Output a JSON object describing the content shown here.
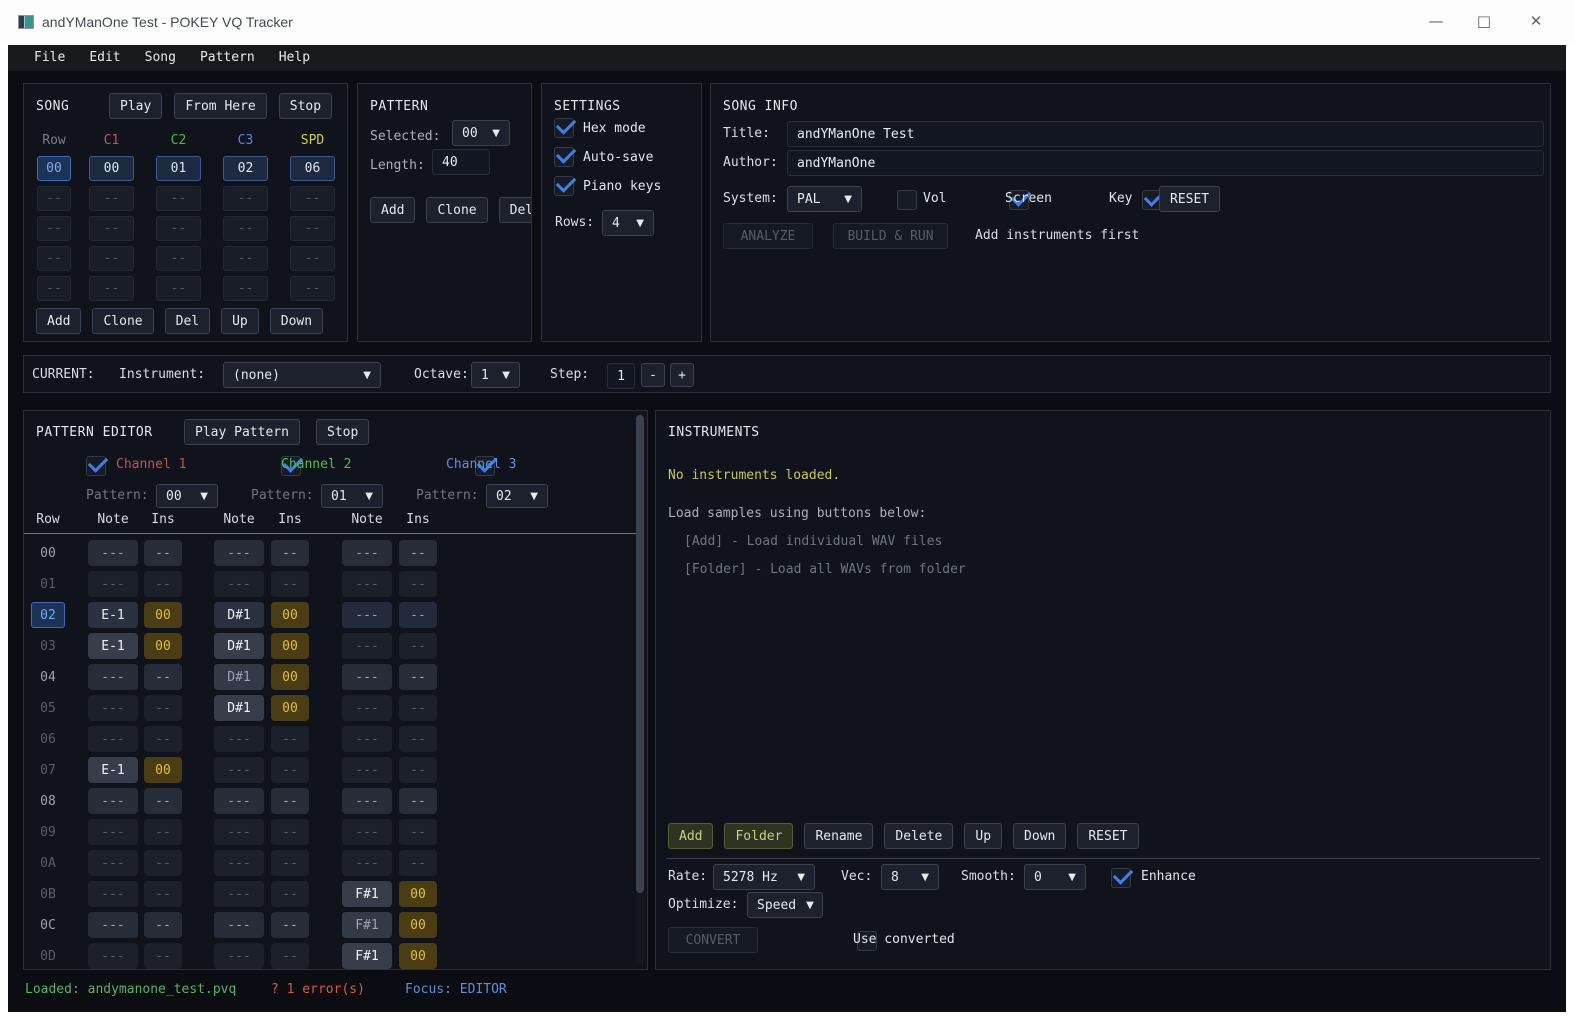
{
  "window": {
    "title": "andYManOne Test - POKEY VQ Tracker",
    "minimize": "—",
    "maximize": "□",
    "close": "✕"
  },
  "menu": [
    "File",
    "Edit",
    "Song",
    "Pattern",
    "Help"
  ],
  "song_panel": {
    "title": "SONG",
    "buttons": [
      "Play",
      "From Here",
      "Stop"
    ],
    "columns": [
      "Row",
      "C1",
      "C2",
      "C3",
      "SPD"
    ],
    "rows": [
      {
        "row": "00",
        "cells": [
          "00",
          "01",
          "02",
          "06"
        ],
        "selected": true
      },
      {
        "row": "--",
        "cells": [
          "--",
          "--",
          "--",
          "--"
        ],
        "selected": false
      },
      {
        "row": "--",
        "cells": [
          "--",
          "--",
          "--",
          "--"
        ],
        "selected": false
      },
      {
        "row": "--",
        "cells": [
          "--",
          "--",
          "--",
          "--"
        ],
        "selected": false
      },
      {
        "row": "--",
        "cells": [
          "--",
          "--",
          "--",
          "--"
        ],
        "selected": false
      }
    ],
    "footer_buttons": [
      "Add",
      "Clone",
      "Del",
      "Up",
      "Down"
    ]
  },
  "pattern_panel": {
    "title": "PATTERN",
    "selected_label": "Selected:",
    "selected_value": "00",
    "length_label": "Length:",
    "length_value": "40",
    "buttons": [
      "Add",
      "Clone",
      "Del"
    ]
  },
  "settings_panel": {
    "title": "SETTINGS",
    "checkboxes": [
      {
        "label": "Hex mode",
        "checked": true
      },
      {
        "label": "Auto-save",
        "checked": true
      },
      {
        "label": "Piano keys",
        "checked": true
      }
    ],
    "rows_label": "Rows:",
    "rows_value": "4"
  },
  "song_info": {
    "title": "SONG INFO",
    "title_label": "Title:",
    "title_value": "andYManOne Test",
    "author_label": "Author:",
    "author_value": "andYManOne",
    "system_label": "System:",
    "system_value": "PAL",
    "vol_label": "Vol",
    "vol_checked": false,
    "screen_label": "Screen",
    "screen_checked": true,
    "key_label": "Key",
    "key_checked": true,
    "reset_label": "RESET",
    "analyze_label": "ANALYZE",
    "build_label": "BUILD & RUN",
    "hint": "Add instruments first"
  },
  "current_bar": {
    "label": "CURRENT:",
    "instrument_label": "Instrument:",
    "instrument_value": "(none)",
    "octave_label": "Octave:",
    "octave_value": "1",
    "step_label": "Step:",
    "step_value": "1",
    "minus_label": "-",
    "plus_label": "+"
  },
  "pattern_editor": {
    "title": "PATTERN EDITOR",
    "play_label": "Play Pattern",
    "stop_label": "Stop",
    "pattern_label": "Pattern:",
    "channels": [
      {
        "label": "Channel 1",
        "checked": true,
        "color": "#c75050",
        "pattern_value": "00"
      },
      {
        "label": "Channel 2",
        "checked": true,
        "color": "#4fbf4f",
        "pattern_value": "01"
      },
      {
        "label": "Channel 3",
        "checked": true,
        "color": "#5d8fdd",
        "pattern_value": "02"
      }
    ],
    "columns": [
      "Row",
      "Note",
      "Ins",
      "Note",
      "Ins",
      "Note",
      "Ins"
    ],
    "rows": [
      {
        "row": "00",
        "beat": true,
        "selected": false,
        "cells": [
          {
            "note": "---",
            "ins": "--"
          },
          {
            "note": "---",
            "ins": "--"
          },
          {
            "note": "---",
            "ins": "--"
          }
        ]
      },
      {
        "row": "01",
        "beat": false,
        "selected": false,
        "cells": [
          {
            "note": "---",
            "ins": "--"
          },
          {
            "note": "---",
            "ins": "--"
          },
          {
            "note": "---",
            "ins": "--"
          }
        ]
      },
      {
        "row": "02",
        "beat": false,
        "selected": true,
        "cells": [
          {
            "note": "E-1",
            "ins": "00"
          },
          {
            "note": "D#1",
            "ins": "00"
          },
          {
            "note": "---",
            "ins": "--",
            "cursor": true
          }
        ]
      },
      {
        "row": "03",
        "beat": false,
        "selected": false,
        "cells": [
          {
            "note": "E-1",
            "ins": "00"
          },
          {
            "note": "D#1",
            "ins": "00"
          },
          {
            "note": "---",
            "ins": "--"
          }
        ]
      },
      {
        "row": "04",
        "beat": true,
        "selected": false,
        "cells": [
          {
            "note": "---",
            "ins": "--"
          },
          {
            "note": "D#1",
            "ins": "00"
          },
          {
            "note": "---",
            "ins": "--"
          }
        ]
      },
      {
        "row": "05",
        "beat": false,
        "selected": false,
        "cells": [
          {
            "note": "---",
            "ins": "--"
          },
          {
            "note": "D#1",
            "ins": "00"
          },
          {
            "note": "---",
            "ins": "--"
          }
        ]
      },
      {
        "row": "06",
        "beat": false,
        "selected": false,
        "cells": [
          {
            "note": "---",
            "ins": "--"
          },
          {
            "note": "---",
            "ins": "--"
          },
          {
            "note": "---",
            "ins": "--"
          }
        ]
      },
      {
        "row": "07",
        "beat": false,
        "selected": false,
        "cells": [
          {
            "note": "E-1",
            "ins": "00"
          },
          {
            "note": "---",
            "ins": "--"
          },
          {
            "note": "---",
            "ins": "--"
          }
        ]
      },
      {
        "row": "08",
        "beat": true,
        "selected": false,
        "cells": [
          {
            "note": "---",
            "ins": "--"
          },
          {
            "note": "---",
            "ins": "--"
          },
          {
            "note": "---",
            "ins": "--"
          }
        ]
      },
      {
        "row": "09",
        "beat": false,
        "selected": false,
        "cells": [
          {
            "note": "---",
            "ins": "--"
          },
          {
            "note": "---",
            "ins": "--"
          },
          {
            "note": "---",
            "ins": "--"
          }
        ]
      },
      {
        "row": "0A",
        "beat": false,
        "selected": false,
        "cells": [
          {
            "note": "---",
            "ins": "--"
          },
          {
            "note": "---",
            "ins": "--"
          },
          {
            "note": "---",
            "ins": "--"
          }
        ]
      },
      {
        "row": "0B",
        "beat": false,
        "selected": false,
        "cells": [
          {
            "note": "---",
            "ins": "--"
          },
          {
            "note": "---",
            "ins": "--"
          },
          {
            "note": "F#1",
            "ins": "00"
          }
        ]
      },
      {
        "row": "0C",
        "beat": true,
        "selected": false,
        "cells": [
          {
            "note": "---",
            "ins": "--"
          },
          {
            "note": "---",
            "ins": "--"
          },
          {
            "note": "F#1",
            "ins": "00"
          }
        ]
      },
      {
        "row": "0D",
        "beat": false,
        "selected": false,
        "cells": [
          {
            "note": "---",
            "ins": "--"
          },
          {
            "note": "---",
            "ins": "--"
          },
          {
            "note": "F#1",
            "ins": "00"
          }
        ]
      }
    ]
  },
  "instruments_panel": {
    "title": "INSTRUMENTS",
    "empty_message": "No instruments loaded.",
    "hint_heading": "Load samples using buttons below:",
    "hint_line1": "[Add] - Load individual WAV files",
    "hint_line2": "[Folder] - Load all WAVs from folder",
    "buttons": [
      {
        "label": "Add",
        "accent": true
      },
      {
        "label": "Folder",
        "accent": true
      },
      {
        "label": "Rename",
        "accent": false
      },
      {
        "label": "Delete",
        "accent": false
      },
      {
        "label": "Up",
        "accent": false
      },
      {
        "label": "Down",
        "accent": false
      },
      {
        "label": "RESET",
        "accent": false
      }
    ],
    "rate_label": "Rate:",
    "rate_value": "5278 Hz",
    "vec_label": "Vec:",
    "vec_value": "8",
    "smooth_label": "Smooth:",
    "smooth_value": "0",
    "enhance_label": "Enhance",
    "enhance_checked": true,
    "optimize_label": "Optimize:",
    "optimize_value": "Speed",
    "convert_label": "CONVERT",
    "use_converted_label": "Use converted",
    "use_converted_checked": false
  },
  "status_bar": {
    "loaded": "Loaded: andymanone_test.pvq",
    "errors": "? 1 error(s)",
    "focus": "Focus: EDITOR"
  },
  "colors": {
    "accent_blue": "#3f80e8",
    "channel1_red": "#c75050",
    "channel2_green": "#4fbf4f",
    "channel3_blue": "#5d8fdd",
    "spd_yellow": "#cfcf5a",
    "ins_yellow": "#dfbd46",
    "status_green": "#55b368",
    "status_red": "#d95555",
    "status_blue": "#5b8fd9",
    "warning_yellow": "#c9c465",
    "panel_bg": "#10131c",
    "app_bg": "#0b0d13"
  }
}
